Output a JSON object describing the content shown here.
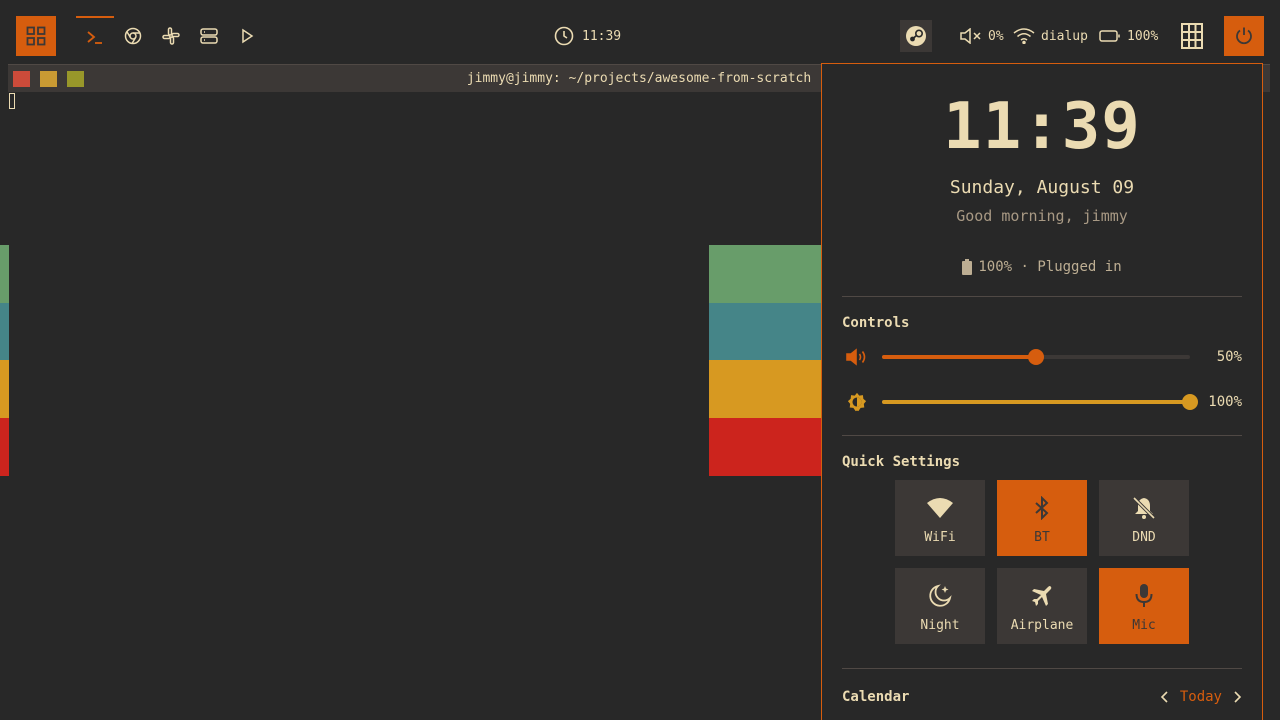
{
  "colors": {
    "accent": "#d65d0e",
    "fg": "#ebdbb2",
    "bg": "#282828",
    "yellow": "#d79921",
    "wallpaper_stripes": [
      "#689d6a",
      "#458588",
      "#d79921",
      "#cc241d"
    ]
  },
  "topbar": {
    "launcher_icon": "app-grid-icon",
    "tasks": [
      {
        "name": "terminal",
        "icon": "terminal-icon",
        "active": true
      },
      {
        "name": "chrome",
        "icon": "chrome-icon",
        "active": false
      },
      {
        "name": "slack",
        "icon": "slack-icon",
        "active": false
      },
      {
        "name": "servers",
        "icon": "server-icon",
        "active": false
      },
      {
        "name": "play",
        "icon": "play-icon",
        "active": false
      }
    ],
    "clock": "11:39",
    "volume": "0%",
    "network": "dialup",
    "battery": "100%"
  },
  "terminal": {
    "title": "jimmy@jimmy: ~/projects/awesome-from-scratch"
  },
  "panel": {
    "time": "11:39",
    "date": "Sunday, August 09",
    "greeting": "Good morning, jimmy",
    "battery_status": "100% · Plugged in",
    "controls_title": "Controls",
    "volume": {
      "value": 50,
      "label": "50%"
    },
    "brightness": {
      "value": 100,
      "label": "100%"
    },
    "quick_title": "Quick Settings",
    "tiles": [
      {
        "label": "WiFi",
        "icon": "wifi-icon",
        "on": false
      },
      {
        "label": "BT",
        "icon": "bluetooth-icon",
        "on": true
      },
      {
        "label": "DND",
        "icon": "bell-off-icon",
        "on": false
      },
      {
        "label": "Night",
        "icon": "moon-icon",
        "on": false
      },
      {
        "label": "Airplane",
        "icon": "airplane-icon",
        "on": false
      },
      {
        "label": "Mic",
        "icon": "microphone-icon",
        "on": true
      }
    ],
    "calendar_title": "Calendar",
    "calendar_today": "Today"
  }
}
